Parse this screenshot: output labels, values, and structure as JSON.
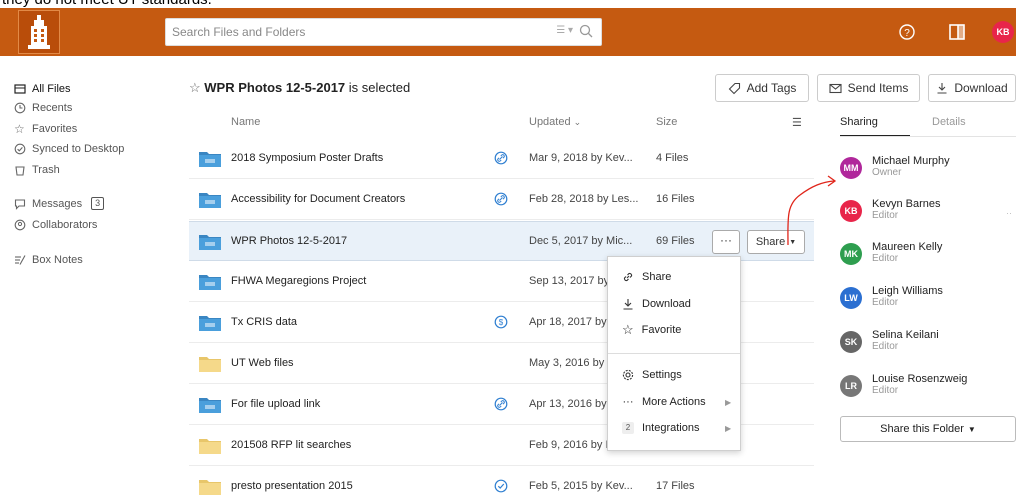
{
  "caption": "they do not meet UT standards.",
  "header": {
    "search_placeholder": "Search Files and Folders",
    "avatar_initials": "KB"
  },
  "sidebar": {
    "items": [
      {
        "label": "All Files",
        "icon": "all-files-icon"
      },
      {
        "label": "Recents",
        "icon": "clock-icon"
      },
      {
        "label": "Favorites",
        "icon": "star-icon"
      },
      {
        "label": "Synced to Desktop",
        "icon": "check-circle-icon"
      },
      {
        "label": "Trash",
        "icon": "trash-icon"
      },
      {
        "label": "Messages",
        "icon": "message-icon",
        "count": "3"
      },
      {
        "label": "Collaborators",
        "icon": "collaborators-icon"
      },
      {
        "label": "Box Notes",
        "icon": "notes-icon"
      }
    ]
  },
  "main": {
    "selection_name": "WPR Photos 12-5-2017",
    "selection_suffix": " is selected",
    "actions": {
      "add_tags": "Add Tags",
      "send_items": "Send Items",
      "download": "Download"
    },
    "columns": {
      "name": "Name",
      "updated": "Updated",
      "size": "Size"
    },
    "rows": [
      {
        "name": "2018 Symposium Poster Drafts",
        "updated": "Mar 9, 2018 by Kev...",
        "size": "4 Files",
        "shared": true,
        "sync": "link"
      },
      {
        "name": "Accessibility for Document Creators",
        "updated": "Feb 28, 2018 by Les...",
        "size": "16 Files",
        "shared": true,
        "sync": "link"
      },
      {
        "name": "WPR Photos 12-5-2017",
        "updated": "Dec 5, 2017 by Mic...",
        "size": "69 Files",
        "shared": true,
        "sync": ""
      },
      {
        "name": "FHWA Megaregions Project",
        "updated": "Sep 13, 2017 by",
        "size": "",
        "shared": true,
        "sync": ""
      },
      {
        "name": "Tx CRIS data",
        "updated": "Apr 18, 2017 by",
        "size": "",
        "shared": true,
        "sync": "dollar"
      },
      {
        "name": "UT Web files",
        "updated": "May 3, 2016 by",
        "size": "",
        "shared": false,
        "sync": ""
      },
      {
        "name": "For file upload link",
        "updated": "Apr 13, 2016 by",
        "size": "",
        "shared": true,
        "sync": "link"
      },
      {
        "name": "201508 RFP lit searches",
        "updated": "Feb 9, 2016 by I",
        "size": "",
        "shared": false,
        "sync": ""
      },
      {
        "name": "presto presentation 2015",
        "updated": "Feb 5, 2015 by Kev...",
        "size": "17 Files",
        "shared": false,
        "sync": "check"
      }
    ],
    "more_label": "···",
    "share_label": "Share"
  },
  "menu": {
    "items": [
      {
        "label": "Share",
        "icon": "link-icon"
      },
      {
        "label": "Download",
        "icon": "download-icon"
      },
      {
        "label": "Favorite",
        "icon": "star-icon"
      },
      {
        "label": "Settings",
        "icon": "gear-icon"
      },
      {
        "label": "More Actions",
        "icon": "ellipsis-icon"
      },
      {
        "label": "Integrations",
        "icon": "integrations-icon",
        "badge": "2"
      }
    ]
  },
  "panel": {
    "tabs": {
      "sharing": "Sharing",
      "details": "Details"
    },
    "people": [
      {
        "initials": "MM",
        "name": "Michael Murphy",
        "role": "Owner",
        "color": "#b0279b"
      },
      {
        "initials": "KB",
        "name": "Kevyn Barnes",
        "role": "Editor",
        "color": "#e8254a"
      },
      {
        "initials": "MK",
        "name": "Maureen Kelly",
        "role": "Editor",
        "color": "#2e9e4f"
      },
      {
        "initials": "LW",
        "name": "Leigh Williams",
        "role": "Editor",
        "color": "#2b6fd1"
      },
      {
        "initials": "SK",
        "name": "Selina Keilani",
        "role": "Editor",
        "color": "#666666"
      },
      {
        "initials": "LR",
        "name": "Louise Rosenzweig",
        "role": "Editor",
        "color": "#777777"
      }
    ],
    "share_folder": "Share this Folder"
  },
  "colors": {
    "brand": "#c55a11",
    "accent": "#0061d5",
    "selected_row": "#e9f1f9",
    "annotation": "#e0261b"
  }
}
